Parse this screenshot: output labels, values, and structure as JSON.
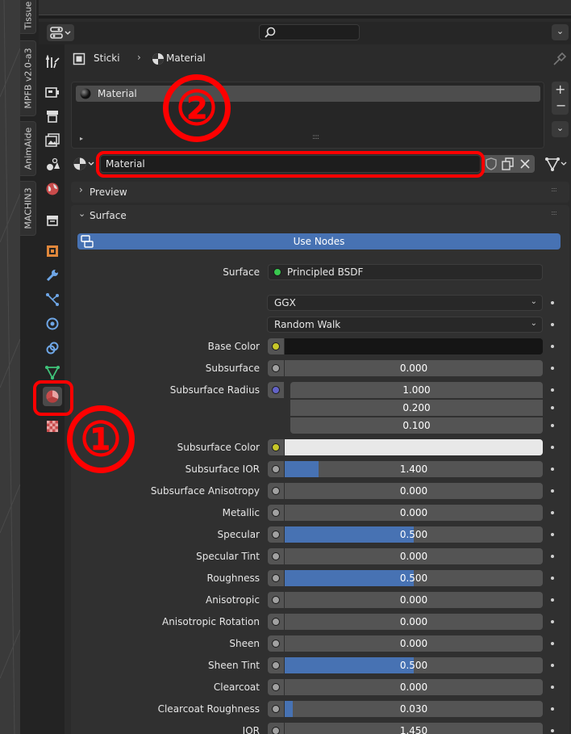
{
  "viewport_tabs": [
    {
      "label": "Tissue"
    },
    {
      "label": "MPFB v2.0-a3"
    },
    {
      "label": "AnimAide"
    },
    {
      "label": "MACHIN3"
    }
  ],
  "header": {
    "search_icon": "search-icon",
    "collapse_icon": "chevron-down-icon"
  },
  "breadcrumb": {
    "object": "Sticki",
    "material": "Material"
  },
  "slots": {
    "items": [
      "Material"
    ]
  },
  "datablock": {
    "name": "Material"
  },
  "panels": {
    "preview": "Preview",
    "surface": "Surface"
  },
  "use_nodes": "Use Nodes",
  "surface": {
    "label": "Surface",
    "shader": "Principled BSDF"
  },
  "dropdowns": [
    {
      "value": "GGX"
    },
    {
      "value": "Random Walk"
    }
  ],
  "props": [
    {
      "label": "Base Color",
      "type": "color",
      "socket": "#c7c729",
      "color": "#151515"
    },
    {
      "label": "Subsurface",
      "type": "value",
      "socket": "#a1a1a1",
      "value": "0.000",
      "fill": 0
    },
    {
      "label": "Subsurface Radius",
      "type": "vector",
      "socket": "#6363c7",
      "values": [
        "1.000",
        "0.200",
        "0.100"
      ]
    },
    {
      "label": "Subsurface Color",
      "type": "color",
      "socket": "#c7c729",
      "color": "#e8e8e8"
    },
    {
      "label": "Subsurface IOR",
      "type": "value",
      "socket": "#a1a1a1",
      "value": "1.400",
      "fill": 0.13
    },
    {
      "label": "Subsurface Anisotropy",
      "type": "value",
      "socket": "#a1a1a1",
      "value": "0.000",
      "fill": 0
    },
    {
      "label": "Metallic",
      "type": "value",
      "socket": "#a1a1a1",
      "value": "0.000",
      "fill": 0
    },
    {
      "label": "Specular",
      "type": "value",
      "socket": "#a1a1a1",
      "value": "0.500",
      "fill": 0.5
    },
    {
      "label": "Specular Tint",
      "type": "value",
      "socket": "#a1a1a1",
      "value": "0.000",
      "fill": 0
    },
    {
      "label": "Roughness",
      "type": "value",
      "socket": "#a1a1a1",
      "value": "0.500",
      "fill": 0.5
    },
    {
      "label": "Anisotropic",
      "type": "value",
      "socket": "#a1a1a1",
      "value": "0.000",
      "fill": 0
    },
    {
      "label": "Anisotropic Rotation",
      "type": "value",
      "socket": "#a1a1a1",
      "value": "0.000",
      "fill": 0
    },
    {
      "label": "Sheen",
      "type": "value",
      "socket": "#a1a1a1",
      "value": "0.000",
      "fill": 0
    },
    {
      "label": "Sheen Tint",
      "type": "value",
      "socket": "#a1a1a1",
      "value": "0.500",
      "fill": 0.5
    },
    {
      "label": "Clearcoat",
      "type": "value",
      "socket": "#a1a1a1",
      "value": "0.000",
      "fill": 0
    },
    {
      "label": "Clearcoat Roughness",
      "type": "value",
      "socket": "#a1a1a1",
      "value": "0.030",
      "fill": 0.03
    },
    {
      "label": "IOR",
      "type": "value",
      "socket": "#a1a1a1",
      "value": "1.450",
      "fill": 0
    }
  ],
  "callouts": {
    "one": "①",
    "two": "②",
    "color": "#ff0000"
  },
  "colors": {
    "accent": "#4772b3",
    "panel": "#303030",
    "field": "#545454"
  }
}
